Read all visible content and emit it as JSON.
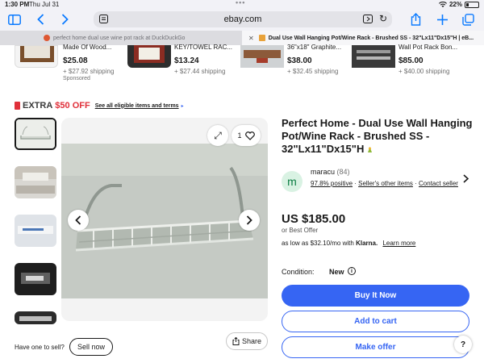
{
  "status_bar": {
    "time": "1:30 PM",
    "date": "Thu Jul 31",
    "dots": "•••",
    "battery": "22%"
  },
  "browser": {
    "url": "ebay.com",
    "tabs": [
      {
        "label": "perfect home dual use wine pot rack at DuckDuckGo",
        "active": false
      },
      {
        "label": "Dual Use Wall Hanging Pot/Wine Rack - Brushed SS - 32\"Lx11\"Dx15\"H | eB...",
        "active": true
      }
    ],
    "icons": [
      "sidebar-icon",
      "back-icon",
      "forward-icon",
      "reader-icon",
      "extension-icon",
      "reload-icon",
      "share-icon",
      "new-tab-icon",
      "tabs-icon"
    ]
  },
  "carousel": [
    {
      "name": "Made Of Wood...",
      "price": "$25.08",
      "shipping": "+ $27.92 shipping",
      "sponsored": "Sponsored"
    },
    {
      "name": "KEY/TOWEL RAC...",
      "price": "$13.24",
      "shipping": "+ $27.44 shipping"
    },
    {
      "name": "36\"x18\" Graphite...",
      "price": "$38.00",
      "shipping": "+ $32.45 shipping"
    },
    {
      "name": "Wall Pot Rack Bon...",
      "price": "$85.00",
      "shipping": "+ $40.00 shipping"
    }
  ],
  "promo": {
    "prefix": "EXTRA",
    "amount": "$50 OFF",
    "link": "See all eligible items and terms"
  },
  "gallery": {
    "favorites_count": "1"
  },
  "product": {
    "title": "Perfect Home - Dual Use Wall Hanging Pot/Wine Rack - Brushed SS - 32\"Lx11\"Dx15\"H",
    "seller": {
      "initial": "m",
      "name": "maracu",
      "feedback_count": "(84)",
      "positive": "97.8% positive",
      "other_items": "Seller's other items",
      "contact": "Contact seller"
    },
    "price": "US $185.00",
    "best_offer": "or Best Offer",
    "financing": "as low as $32.10/mo with",
    "financing_brand": "Klarna.",
    "learn_more": "Learn more",
    "condition_label": "Condition:",
    "condition_value": "New",
    "buy_now": "Buy It Now",
    "add_to_cart": "Add to cart",
    "make_offer": "Make offer"
  },
  "footer": {
    "have_one": "Have one to sell?",
    "sell_now": "Sell now",
    "share": "Share",
    "help": "?"
  },
  "colors": {
    "accent": "#3665f3",
    "promo_red": "#e0303a",
    "seller_green": "#0a7c42"
  }
}
